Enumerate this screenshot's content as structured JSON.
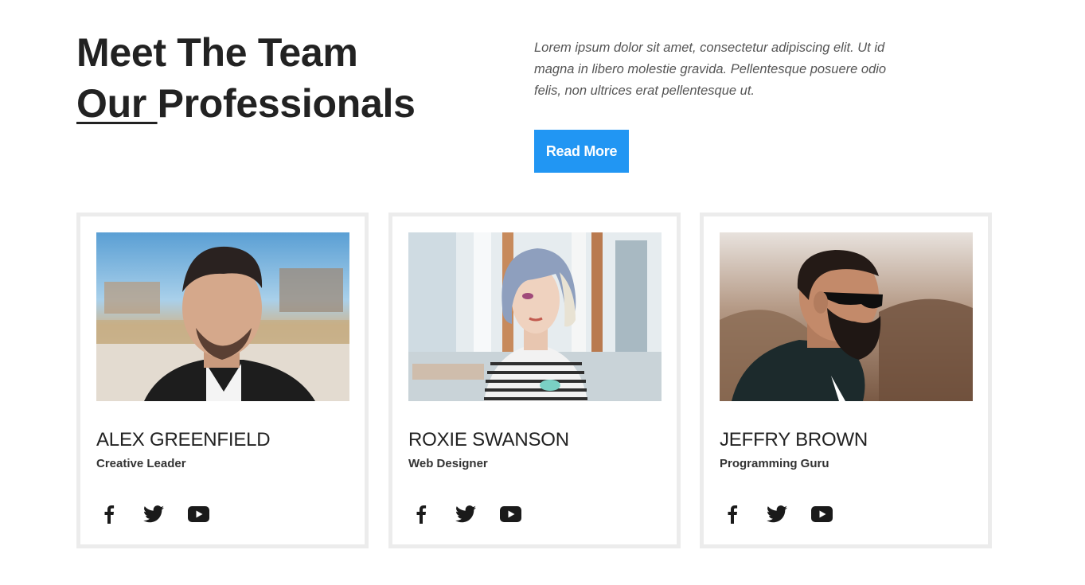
{
  "header": {
    "title_line1": "Meet The Team",
    "title_underlined": "Our ",
    "title_rest": "Professionals",
    "intro": "Lorem ipsum dolor sit amet, consectetur adipiscing elit. Ut id magna in libero molestie gravida. Pellentesque posuere odio felis, non ultrices erat pellentesque ut.",
    "read_more_label": "Read More"
  },
  "colors": {
    "accent": "#2196f3",
    "text": "#222222",
    "card_border": "#ececec"
  },
  "team": [
    {
      "name": "ALEX GREENFIELD",
      "role": "Creative Leader",
      "photo_alt": "Portrait of Alex Greenfield",
      "socials": [
        "facebook-icon",
        "twitter-icon",
        "youtube-icon"
      ]
    },
    {
      "name": "ROXIE SWANSON",
      "role": "Web Designer",
      "photo_alt": "Portrait of Roxie Swanson",
      "socials": [
        "facebook-icon",
        "twitter-icon",
        "youtube-icon"
      ]
    },
    {
      "name": "JEFFRY BROWN",
      "role": "Programming Guru",
      "photo_alt": "Portrait of Jeffry Brown",
      "socials": [
        "facebook-icon",
        "twitter-icon",
        "youtube-icon"
      ]
    }
  ]
}
